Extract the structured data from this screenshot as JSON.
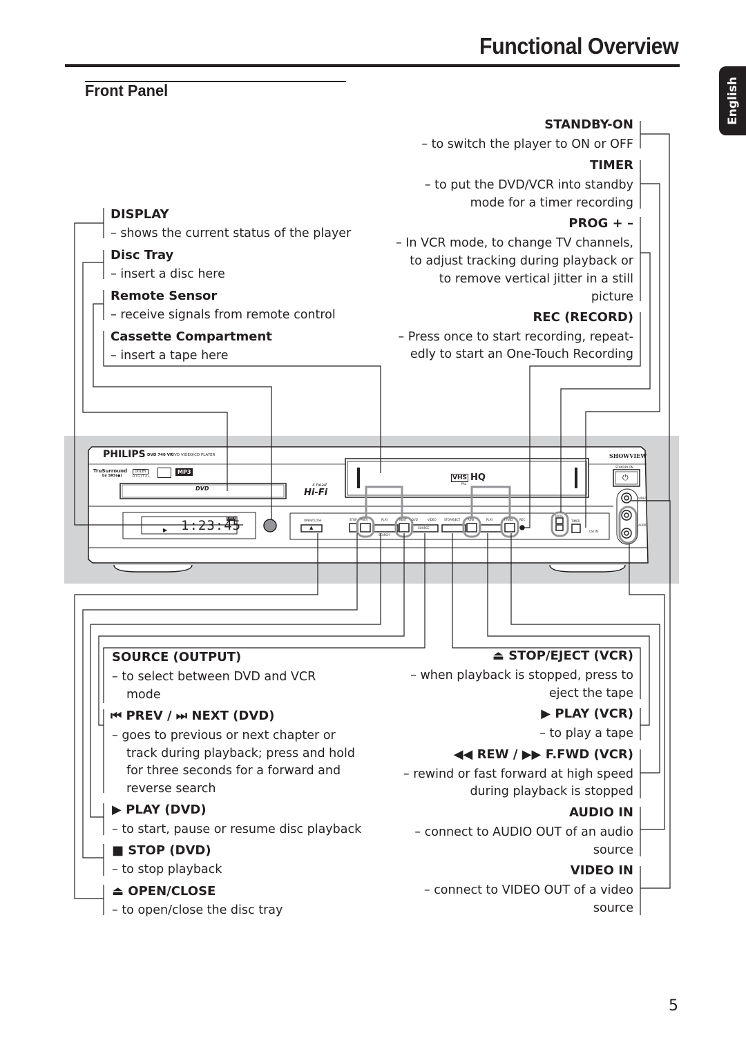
{
  "header": {
    "title": "Functional Overview",
    "section": "Front Panel",
    "language_tab": "English"
  },
  "left_top": [
    {
      "label": "DISPLAY",
      "desc": [
        "– shows the current status of the player"
      ]
    },
    {
      "label": "Disc Tray",
      "desc": [
        "– insert a disc here"
      ]
    },
    {
      "label": "Remote Sensor",
      "desc": [
        "– receive signals from remote control"
      ]
    },
    {
      "label": "Cassette Compartment",
      "desc": [
        "– insert a tape here"
      ]
    }
  ],
  "right_top": [
    {
      "label": "STANDBY-ON",
      "desc": [
        "– to switch the player to ON or OFF"
      ]
    },
    {
      "label": "TIMER",
      "desc": [
        "– to put the DVD/VCR into standby",
        "mode for a timer recording"
      ]
    },
    {
      "label": "PROG + –",
      "desc": [
        "– In VCR mode, to change TV channels,",
        "to adjust tracking during playback or",
        "to remove vertical jitter in a still",
        "picture"
      ]
    },
    {
      "label": "REC (RECORD)",
      "desc": [
        "– Press once to start recording, repeat-",
        "edly to start an One-Touch Recording"
      ]
    }
  ],
  "left_bottom": [
    {
      "label": "SOURCE (OUTPUT)",
      "desc": [
        "– to select between DVD and VCR",
        "mode"
      ]
    },
    {
      "label": "PREV / NEXT (DVD)",
      "icon_prev": "skip-prev-icon",
      "icon_next": "skip-next-icon",
      "prev": "PREV",
      "sep": "/",
      "next": "NEXT (DVD)",
      "desc": [
        "– goes to previous or next chapter or",
        "track during playback; press and hold",
        "for three seconds for a forward and",
        "reverse search"
      ]
    },
    {
      "label": "PLAY (DVD)",
      "icon": "play-icon",
      "desc": [
        "– to start, pause or resume disc playback"
      ]
    },
    {
      "label": "STOP (DVD)",
      "icon": "stop-icon",
      "desc": [
        "– to stop playback"
      ]
    },
    {
      "label": "OPEN/CLOSE",
      "icon": "eject-icon",
      "desc": [
        "–  to open/close the disc tray"
      ]
    }
  ],
  "right_bottom": [
    {
      "label": "STOP/EJECT (VCR)",
      "icon": "eject-icon",
      "desc": [
        "– when playback is stopped, press to",
        "eject the tape"
      ]
    },
    {
      "label": "PLAY (VCR)",
      "icon": "play-icon",
      "desc": [
        "– to play a tape"
      ]
    },
    {
      "label": "REW / F.FWD (VCR)",
      "rew": "REW",
      "sep": "/",
      "ffwd": "F.FWD (VCR)",
      "desc": [
        "– rewind or fast forward at high speed",
        "during playback is stopped"
      ]
    },
    {
      "label": "AUDIO IN",
      "desc": [
        "– connect to AUDIO OUT of an audio",
        "source"
      ]
    },
    {
      "label": "VIDEO IN",
      "desc": [
        "– connect to VIDEO OUT of a video",
        "source"
      ]
    }
  ],
  "device": {
    "brand": "PHILIPS",
    "model": "DVD 740 VR",
    "model_desc": "DVD VIDEO/CD PLAYER",
    "trusurround": "TruSurround",
    "by_srs": "by SRS(●)",
    "dolby": "DOLBY",
    "digital": "DIGITAL",
    "mp3": "MP3",
    "dvd_logo": "DVD",
    "video": "VIDEO",
    "hifi_top": "4 head",
    "hifi": "Hi-Fi",
    "vhs": "VHS",
    "hq": "HQ",
    "pal": "PAL",
    "showview": "SHOWVIEW",
    "standby_on": "STANDBY-ON",
    "display_time": "1:23:45",
    "display_badge": "DVD",
    "btn_open_close": "OPEN/CLOSE",
    "btn_stop": "STOP",
    "btn_prev": "PREV",
    "btn_play": "PLAY",
    "btn_next": "NEXT",
    "led_dvd": "DVD",
    "led_video": "VIDEO",
    "btn_source": "SOURCE",
    "search": "SEARCH",
    "btn_stop_eject": "STOP/EJECT",
    "btn_rew": "REW",
    "btn_play2": "PLAY",
    "btn_ffwd": "F.FWD",
    "btn_rec": "REC",
    "btn_prog": "PROG",
    "btn_timer": "TIMER",
    "cst_in": "CST.IN",
    "jack_video": "VIDEO",
    "jack_audio": "AUDIO"
  },
  "footer": {
    "page_number": "5"
  }
}
